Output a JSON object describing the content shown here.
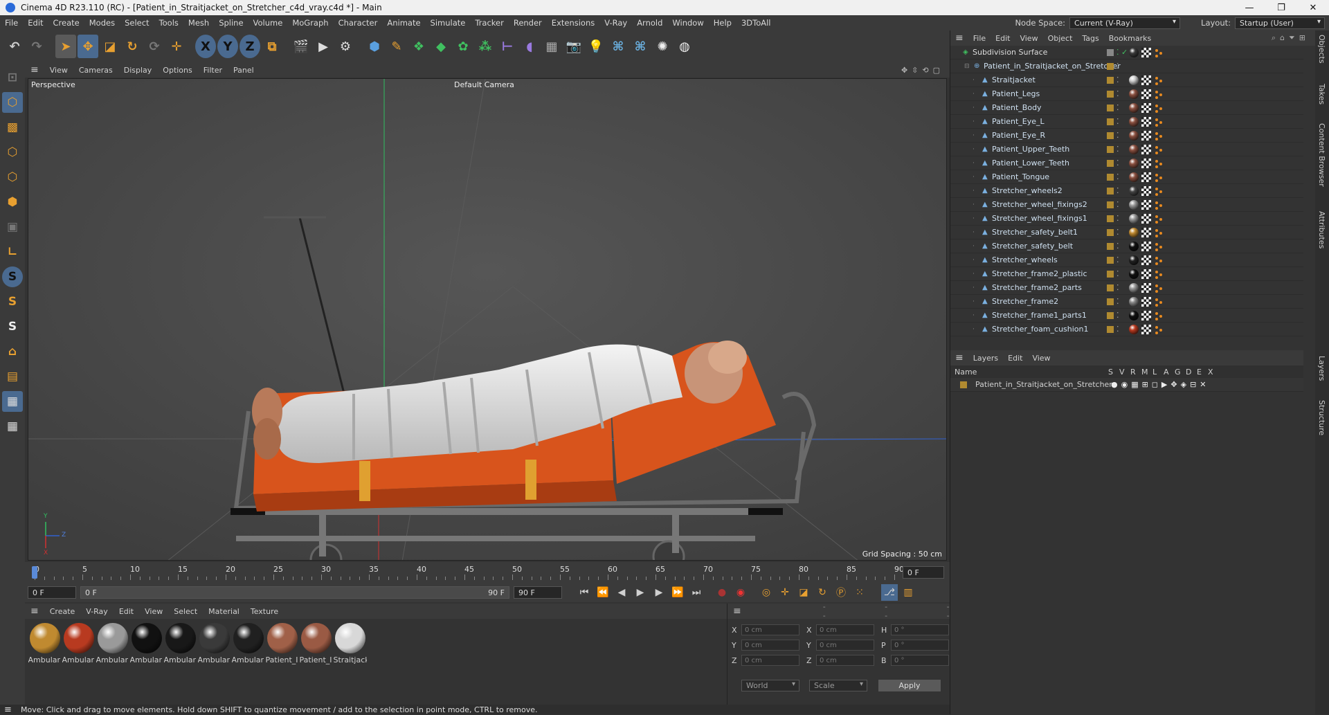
{
  "window": {
    "title": "Cinema 4D R23.110 (RC) - [Patient_in_Straitjacket_on_Stretcher_c4d_vray.c4d *] - Main",
    "min": "—",
    "max": "❐",
    "close": "✕"
  },
  "menu": [
    "File",
    "Edit",
    "Create",
    "Modes",
    "Select",
    "Tools",
    "Mesh",
    "Spline",
    "Volume",
    "MoGraph",
    "Character",
    "Animate",
    "Simulate",
    "Tracker",
    "Render",
    "Extensions",
    "V-Ray",
    "Arnold",
    "Window",
    "Help",
    "3DToAll"
  ],
  "nodespace": {
    "label": "Node Space:",
    "value": "Current (V-Ray)"
  },
  "layout": {
    "label": "Layout:",
    "value": "Startup (User)"
  },
  "viewport": {
    "menu": [
      "View",
      "Cameras",
      "Display",
      "Options",
      "Filter",
      "Panel"
    ],
    "name": "Perspective",
    "camera": "Default Camera",
    "grid": "Grid Spacing : 50 cm",
    "axis_y": "Y",
    "axis_z": "Z",
    "axis_x": "X"
  },
  "timeline": {
    "ticks": [
      "0",
      "5",
      "10",
      "15",
      "20",
      "25",
      "30",
      "35",
      "40",
      "45",
      "50",
      "55",
      "60",
      "65",
      "70",
      "75",
      "80",
      "85",
      "90"
    ],
    "current": "0 F"
  },
  "transport": {
    "start": "0 F",
    "range_start": "0 F",
    "range_end": "90 F",
    "end": "90 F"
  },
  "materials": {
    "menu": [
      "Create",
      "V-Ray",
      "Edit",
      "View",
      "Select",
      "Material",
      "Texture"
    ],
    "items": [
      {
        "label": "Ambular",
        "color": "#c08a30"
      },
      {
        "label": "Ambular",
        "color": "#b83a20"
      },
      {
        "label": "Ambular",
        "color": "#9a9a9a"
      },
      {
        "label": "Ambular",
        "color": "#111111"
      },
      {
        "label": "Ambular",
        "color": "#181818"
      },
      {
        "label": "Ambular",
        "color": "#3a3a3a"
      },
      {
        "label": "Ambular",
        "color": "#202020"
      },
      {
        "label": "Patient_I",
        "color": "#a06048"
      },
      {
        "label": "Patient_I",
        "color": "#9a5a44"
      },
      {
        "label": "Straitjack",
        "color": "#d8d8d8"
      }
    ]
  },
  "coords": {
    "header": [
      "--",
      "--",
      "--"
    ],
    "rows": [
      {
        "a": "X",
        "av": "0 cm",
        "b": "X",
        "bv": "0 cm",
        "c": "H",
        "cv": "0 °"
      },
      {
        "a": "Y",
        "av": "0 cm",
        "b": "Y",
        "bv": "0 cm",
        "c": "P",
        "cv": "0 °"
      },
      {
        "a": "Z",
        "av": "0 cm",
        "b": "Z",
        "bv": "0 cm",
        "c": "B",
        "cv": "0 °"
      }
    ],
    "world": "World",
    "scale": "Scale",
    "apply": "Apply"
  },
  "status": "Move: Click and drag to move elements. Hold down SHIFT to quantize movement / add to the selection in point mode, CTRL to remove.",
  "objects": {
    "menu": [
      "File",
      "Edit",
      "View",
      "Object",
      "Tags",
      "Bookmarks"
    ],
    "rows": [
      {
        "name": "Subdivision Surface",
        "level": 0,
        "tag": "#3a3a3a"
      },
      {
        "name": "Patient_in_Straitjacket_on_Stretcher",
        "level": 1,
        "tag": ""
      },
      {
        "name": "Straitjacket",
        "level": 2,
        "tag": "#cfcfcf"
      },
      {
        "name": "Patient_Legs",
        "level": 2,
        "tag": "#8a5040"
      },
      {
        "name": "Patient_Body",
        "level": 2,
        "tag": "#8a5040"
      },
      {
        "name": "Patient_Eye_L",
        "level": 2,
        "tag": "#8a5040"
      },
      {
        "name": "Patient_Eye_R",
        "level": 2,
        "tag": "#8a5040"
      },
      {
        "name": "Patient_Upper_Teeth",
        "level": 2,
        "tag": "#8a5040"
      },
      {
        "name": "Patient_Lower_Teeth",
        "level": 2,
        "tag": "#8a5040"
      },
      {
        "name": "Patient_Tongue",
        "level": 2,
        "tag": "#8a5040"
      },
      {
        "name": "Stretcher_wheels2",
        "level": 2,
        "tag": "#444"
      },
      {
        "name": "Stretcher_wheel_fixings2",
        "level": 2,
        "tag": "#999"
      },
      {
        "name": "Stretcher_wheel_fixings1",
        "level": 2,
        "tag": "#999"
      },
      {
        "name": "Stretcher_safety_belt1",
        "level": 2,
        "tag": "#c08a30"
      },
      {
        "name": "Stretcher_safety_belt",
        "level": 2,
        "tag": "#111"
      },
      {
        "name": "Stretcher_wheels",
        "level": 2,
        "tag": "#222"
      },
      {
        "name": "Stretcher_frame2_plastic",
        "level": 2,
        "tag": "#111"
      },
      {
        "name": "Stretcher_frame2_parts",
        "level": 2,
        "tag": "#999"
      },
      {
        "name": "Stretcher_frame2",
        "level": 2,
        "tag": "#888"
      },
      {
        "name": "Stretcher_frame1_parts1",
        "level": 2,
        "tag": "#111"
      },
      {
        "name": "Stretcher_foam_cushion1",
        "level": 2,
        "tag": "#b83a20"
      }
    ]
  },
  "layers": {
    "menu": [
      "Layers",
      "Edit",
      "View"
    ],
    "cols": [
      "Name",
      "S",
      "V",
      "R",
      "M",
      "L",
      "A",
      "G",
      "D",
      "E",
      "X"
    ],
    "row": "Patient_in_Straitjacket_on_Stretcher"
  },
  "sidetabs": [
    "Objects",
    "Takes",
    "Content Browser",
    "Attributes",
    "Layers",
    "Structure"
  ]
}
